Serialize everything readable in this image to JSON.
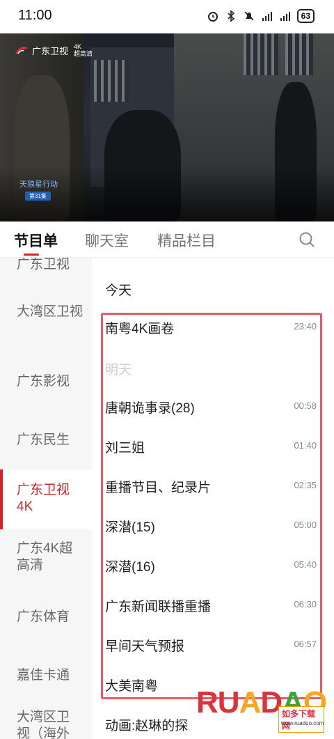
{
  "status_bar": {
    "time": "11:00",
    "battery": "63",
    "icons": [
      "alarm-icon",
      "bluetooth-icon",
      "mute-icon",
      "signal-icon",
      "signal-icon",
      "battery-icon"
    ]
  },
  "player": {
    "channel_logo": "广东卫视",
    "logo_badge_top": "4K",
    "logo_badge_bottom": "超高清",
    "show_title": "天狼星行动",
    "episode": "第31集"
  },
  "tabs": [
    {
      "label": "节目单",
      "active": true
    },
    {
      "label": "聊天室",
      "active": false
    },
    {
      "label": "精品栏目",
      "active": false
    }
  ],
  "sidebar": {
    "items": [
      {
        "label": "广东卫视",
        "active": false
      },
      {
        "label": "大湾区卫视",
        "active": false
      },
      {
        "label": "广东影视",
        "active": false
      },
      {
        "label": "广东民生",
        "active": false
      },
      {
        "label": "广东卫视4K",
        "active": true
      },
      {
        "label": "广东4K超高清",
        "active": false
      },
      {
        "label": "广东体育",
        "active": false
      },
      {
        "label": "嘉佳卡通",
        "active": false
      },
      {
        "label": "大湾区卫视（海外",
        "active": false
      }
    ]
  },
  "schedule": {
    "today_label": "今天",
    "tomorrow_label": "明天",
    "today": [
      {
        "title": "南粤4K画卷",
        "time": "23:40"
      }
    ],
    "tomorrow": [
      {
        "title": "唐朝诡事录(28)",
        "time": "00:58"
      },
      {
        "title": "刘三姐",
        "time": "01:40"
      },
      {
        "title": "重播节目、纪录片",
        "time": "02:35"
      },
      {
        "title": "深潜(15)",
        "time": "05:00"
      },
      {
        "title": "深潜(16)",
        "time": "05:40"
      },
      {
        "title": "广东新闻联播重播",
        "time": "06:30"
      },
      {
        "title": "早间天气预报",
        "time": "06:57"
      },
      {
        "title": "大美南粤",
        "time": ""
      },
      {
        "title": "动画:赵琳的探",
        "time": ""
      }
    ]
  },
  "watermark": {
    "letters": [
      "R",
      "U",
      "A",
      "D",
      "A",
      "O"
    ],
    "badge": "如多下载网",
    "url": "www.ruaduo.com"
  },
  "colors": {
    "accent": "#d3222a",
    "highlight_box": "#e25b66",
    "sidebar_bg": "#f6f6f6"
  }
}
